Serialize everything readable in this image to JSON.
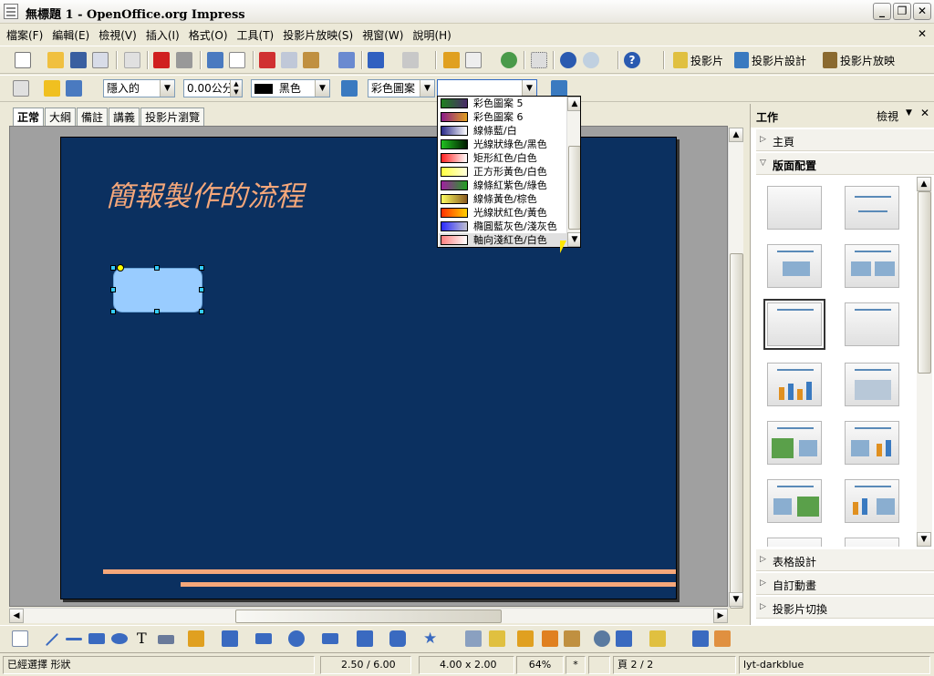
{
  "window": {
    "title": "無標題 1 - OpenOffice.org Impress"
  },
  "menu": [
    "檔案(F)",
    "編輯(E)",
    "檢視(V)",
    "插入(I)",
    "格式(O)",
    "工具(T)",
    "投影片放映(S)",
    "視窗(W)",
    "說明(H)"
  ],
  "standard_toolbar": {
    "slide_label": "投影片",
    "slide_design_label": "投影片設計",
    "slide_show_label": "投影片放映"
  },
  "line_toolbar": {
    "line_style": "隱入的",
    "line_width": "0.00公分",
    "line_color": "黑色",
    "area_style": "彩色圖案",
    "area_fill": ""
  },
  "view_tabs": [
    "正常",
    "大綱",
    "備註",
    "講義",
    "投影片瀏覽"
  ],
  "slide": {
    "title": "簡報製作的流程",
    "bg_color": "#0b3060",
    "accent_color": "#f5a77a",
    "shape_color": "#99ccff"
  },
  "fill_dropdown": {
    "items": [
      {
        "label": "彩色圖案 5",
        "sw1": "#1e7f1e",
        "sw2": "#4a2a6a"
      },
      {
        "label": "彩色圖案 6",
        "sw1": "#8a1a8a",
        "sw2": "#e0a020"
      },
      {
        "label": "線條藍/白",
        "sw1": "#2a2a8a",
        "sw2": "#ffffff"
      },
      {
        "label": "光線狀綠色/黑色",
        "sw1": "#20c020",
        "sw2": "#001a00"
      },
      {
        "label": "矩形紅色/白色",
        "sw1": "#ff2020",
        "sw2": "#ffffff"
      },
      {
        "label": "正方形黃色/白色",
        "sw1": "#ffff40",
        "sw2": "#ffffe0"
      },
      {
        "label": "線條紅紫色/綠色",
        "sw1": "#a020a0",
        "sw2": "#20a020"
      },
      {
        "label": "線條黃色/棕色",
        "sw1": "#ffff60",
        "sw2": "#8a5a20"
      },
      {
        "label": "光線狀紅色/黃色",
        "sw1": "#ff3000",
        "sw2": "#ffd000"
      },
      {
        "label": "橢圓藍灰色/淺灰色",
        "sw1": "#2a2aff",
        "sw2": "#c0c0d0"
      },
      {
        "label": "軸向淺紅色/白色",
        "sw1": "#ff8080",
        "sw2": "#ffffff"
      }
    ],
    "highlighted": 10
  },
  "task_pane": {
    "title": "工作",
    "view_label": "檢視",
    "sections_top": [
      "主頁",
      "版面配置"
    ],
    "sections_bottom": [
      "表格設計",
      "自訂動畫",
      "投影片切換"
    ]
  },
  "status_bar": {
    "selection": "已經選擇 形狀",
    "position": "2.50 / 6.00",
    "size": "4.00 x 2.00",
    "zoom": "64%",
    "modified": "*",
    "page": "頁 2 / 2",
    "layout": "lyt-darkblue"
  }
}
